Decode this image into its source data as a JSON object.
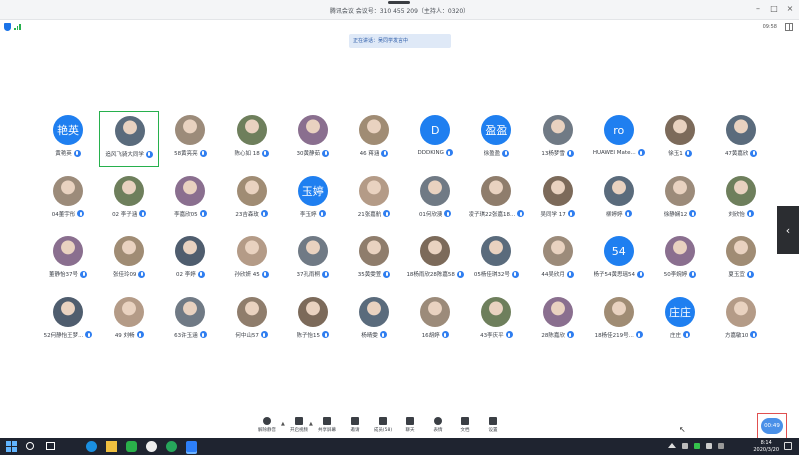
{
  "window": {
    "title": "腾讯会议 会议号：310 455 209（主持人：0320）",
    "time": "09:58"
  },
  "banner": "正在讲话：吴同学发言中",
  "participants": [
    {
      "name": "黄艳英",
      "avatar_text": "艳英",
      "photo": false
    },
    {
      "name": "追风飞骑大同学",
      "avatar_text": "",
      "photo": true,
      "active": true
    },
    {
      "name": "58黄亮亮",
      "avatar_text": "",
      "photo": true
    },
    {
      "name": "陈心如 18",
      "avatar_text": "",
      "photo": true
    },
    {
      "name": "30黄静茹",
      "avatar_text": "",
      "photo": true
    },
    {
      "name": "46 蒋涵",
      "avatar_text": "",
      "photo": true
    },
    {
      "name": "DDDKING",
      "avatar_text": "D",
      "photo": false
    },
    {
      "name": "徐盈盈",
      "avatar_text": "盈盈",
      "photo": false
    },
    {
      "name": "13杨梦雪",
      "avatar_text": "",
      "photo": true
    },
    {
      "name": "HUAWEI Mate...",
      "avatar_text": "ro",
      "photo": false
    },
    {
      "name": "徐玉1",
      "avatar_text": "",
      "photo": true
    },
    {
      "name": "47黄嘉欣",
      "avatar_text": "",
      "photo": true
    },
    {
      "name": "04董宇彤",
      "avatar_text": "",
      "photo": true
    },
    {
      "name": "02 李子涵",
      "avatar_text": "",
      "photo": true
    },
    {
      "name": "李嘉欣05",
      "avatar_text": "",
      "photo": true
    },
    {
      "name": "23吉森玫",
      "avatar_text": "",
      "photo": true
    },
    {
      "name": "李玉婷",
      "avatar_text": "玉婷",
      "photo": false
    },
    {
      "name": "21张嘉航",
      "avatar_text": "",
      "photo": true
    },
    {
      "name": "01何欣澳",
      "avatar_text": "",
      "photo": true
    },
    {
      "name": "凌子琪22张嘉18...",
      "avatar_text": "",
      "photo": true
    },
    {
      "name": "吴同学 17",
      "avatar_text": "",
      "photo": true
    },
    {
      "name": "柳婷婷",
      "avatar_text": "",
      "photo": true
    },
    {
      "name": "徐静娴12",
      "avatar_text": "",
      "photo": true
    },
    {
      "name": "刘欣怡",
      "avatar_text": "",
      "photo": true
    },
    {
      "name": "董静怡37号",
      "avatar_text": "",
      "photo": true
    },
    {
      "name": "张佳玲09",
      "avatar_text": "",
      "photo": true
    },
    {
      "name": "02 李婷",
      "avatar_text": "",
      "photo": true
    },
    {
      "name": "孙欣妍 45",
      "avatar_text": "",
      "photo": true
    },
    {
      "name": "37孔雨桐",
      "avatar_text": "",
      "photo": true
    },
    {
      "name": "35黄雯萱",
      "avatar_text": "",
      "photo": true
    },
    {
      "name": "18杨雨欣28陈嘉58",
      "avatar_text": "",
      "photo": true
    },
    {
      "name": "05杨佳琪32号",
      "avatar_text": "",
      "photo": true
    },
    {
      "name": "44吴欣月",
      "avatar_text": "",
      "photo": true
    },
    {
      "name": "杨子54黄思瑶54",
      "avatar_text": "54",
      "photo": false
    },
    {
      "name": "50李婉婷",
      "avatar_text": "",
      "photo": true
    },
    {
      "name": "夏玉宜",
      "avatar_text": "",
      "photo": true
    },
    {
      "name": "52何静怡王梦...",
      "avatar_text": "",
      "photo": true
    },
    {
      "name": "49 刘畅",
      "avatar_text": "",
      "photo": true
    },
    {
      "name": "63许玉涵",
      "avatar_text": "",
      "photo": true
    },
    {
      "name": "何中山57",
      "avatar_text": "",
      "photo": true
    },
    {
      "name": "陈子怡15",
      "avatar_text": "",
      "photo": true
    },
    {
      "name": "杨晴雯",
      "avatar_text": "",
      "photo": true
    },
    {
      "name": "16胡婷",
      "avatar_text": "",
      "photo": true
    },
    {
      "name": "43李庆平",
      "avatar_text": "",
      "photo": true
    },
    {
      "name": "28陈嘉欣",
      "avatar_text": "",
      "photo": true
    },
    {
      "name": "18杨佳219号...",
      "avatar_text": "",
      "photo": true
    },
    {
      "name": "庄庄",
      "avatar_text": "庄庄",
      "photo": false
    },
    {
      "name": "方嘉敏10",
      "avatar_text": "",
      "photo": true
    }
  ],
  "toolbar": {
    "items": [
      {
        "label": "解除静音",
        "icon": "microphone-icon"
      },
      {
        "label": "开启视频",
        "icon": "camera-icon"
      },
      {
        "label": "共享屏幕",
        "icon": "share-screen-icon"
      },
      {
        "label": "邀请",
        "icon": "invite-icon"
      },
      {
        "label": "成员(58)",
        "icon": "members-icon"
      },
      {
        "label": "聊天",
        "icon": "chat-icon"
      },
      {
        "label": "表情",
        "icon": "emoji-icon"
      },
      {
        "label": "文档",
        "icon": "document-icon"
      },
      {
        "label": "设置",
        "icon": "settings-icon"
      }
    ],
    "timer": "00:49"
  },
  "taskbar": {
    "time": "8:14",
    "date": "2020/3/20"
  },
  "colors": {
    "accent": "#1f7ff0",
    "active_border": "#27b04d",
    "taskbar": "#1f2430"
  }
}
